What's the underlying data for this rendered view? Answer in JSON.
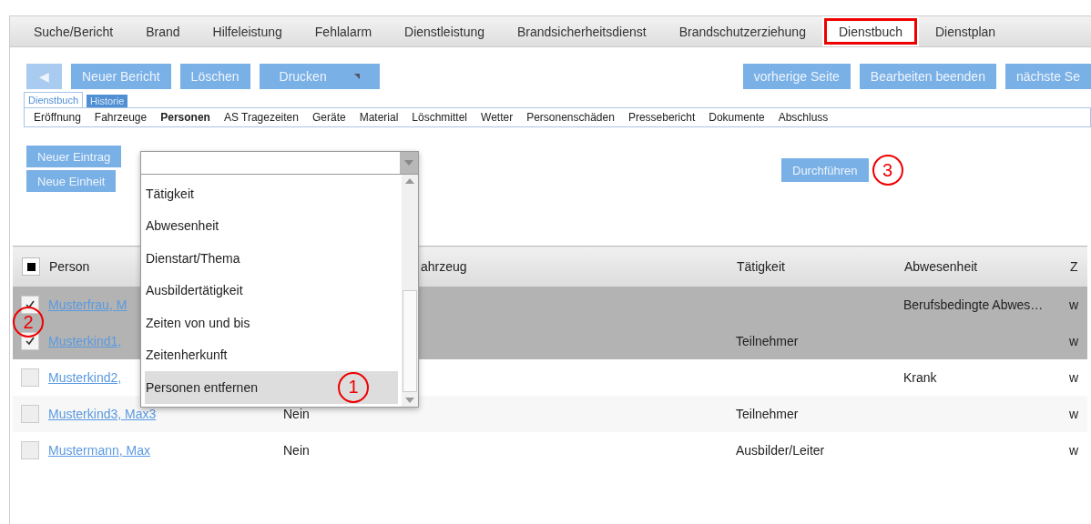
{
  "main_tabs": [
    {
      "label": "Suche/Bericht",
      "selected": false,
      "highlighted": false
    },
    {
      "label": "Brand",
      "selected": false,
      "highlighted": false
    },
    {
      "label": "Hilfeleistung",
      "selected": false,
      "highlighted": false
    },
    {
      "label": "Fehlalarm",
      "selected": false,
      "highlighted": false
    },
    {
      "label": "Dienstleistung",
      "selected": false,
      "highlighted": false
    },
    {
      "label": "Brandsicherheitsdienst",
      "selected": false,
      "highlighted": false
    },
    {
      "label": "Brandschutzerziehung",
      "selected": false,
      "highlighted": false
    },
    {
      "label": "Dienstbuch",
      "selected": true,
      "highlighted": true
    },
    {
      "label": "Dienstplan",
      "selected": false,
      "highlighted": false
    }
  ],
  "toolbar_left": [
    {
      "kind": "back",
      "label": "◀"
    },
    {
      "kind": "button",
      "label": "Neuer Bericht"
    },
    {
      "kind": "button",
      "label": "Löschen"
    },
    {
      "kind": "menu",
      "label": "Drucken"
    }
  ],
  "toolbar_right": [
    "vorherige Seite",
    "Bearbeiten beenden",
    "nächste Se"
  ],
  "sub_tabs": [
    {
      "label": "Dienstbuch",
      "selected": true
    },
    {
      "label": "Historie",
      "selected": false
    }
  ],
  "sections": [
    {
      "label": "Eröffnung",
      "selected": false
    },
    {
      "label": "Fahrzeuge",
      "selected": false
    },
    {
      "label": "Personen",
      "selected": true
    },
    {
      "label": "AS Tragezeiten",
      "selected": false
    },
    {
      "label": "Geräte",
      "selected": false
    },
    {
      "label": "Material",
      "selected": false
    },
    {
      "label": "Löschmittel",
      "selected": false
    },
    {
      "label": "Wetter",
      "selected": false
    },
    {
      "label": "Personenschäden",
      "selected": false
    },
    {
      "label": "Pressebericht",
      "selected": false
    },
    {
      "label": "Dokumente",
      "selected": false
    },
    {
      "label": "Abschluss",
      "selected": false
    }
  ],
  "entry_buttons": [
    "Neuer Eintrag",
    "Neue Einheit"
  ],
  "action_dropdown": {
    "options": [
      {
        "label": "Tätigkeit",
        "selected": false
      },
      {
        "label": "Abwesenheit",
        "selected": false
      },
      {
        "label": "Dienstart/Thema",
        "selected": false
      },
      {
        "label": "Ausbildertätigkeit",
        "selected": false
      },
      {
        "label": "Zeiten von und bis",
        "selected": false
      },
      {
        "label": "Zeitenherkunft",
        "selected": false
      },
      {
        "label": "Personen entfernen",
        "selected": true,
        "marker": "1"
      }
    ]
  },
  "execute_button": {
    "label": "Durchführen",
    "marker": "3"
  },
  "table": {
    "select_all_checked": true,
    "columns": [
      "Person",
      "ahrzeug",
      "Tätigkeit",
      "Abwesenheit",
      "Z"
    ],
    "rows": [
      {
        "person": "Musterfrau, M",
        "column_2": "",
        "vehicle": "",
        "activity": "",
        "absence": "Berufsbedingte Abwes…",
        "column_6": "w",
        "checked": true,
        "selected": true
      },
      {
        "person": "Musterkind1, ",
        "column_2": "",
        "vehicle": "",
        "activity": "Teilnehmer",
        "absence": "",
        "column_6": "w",
        "checked": true,
        "selected": true
      },
      {
        "person": "Musterkind2, ",
        "column_2": "",
        "vehicle": "",
        "activity": "",
        "absence": "Krank",
        "column_6": "w",
        "checked": false,
        "selected": false
      },
      {
        "person": "Musterkind3, Max3",
        "column_2": "Nein",
        "vehicle": "",
        "activity": "Teilnehmer",
        "absence": "",
        "column_6": "w",
        "checked": false,
        "selected": false
      },
      {
        "person": "Mustermann, Max",
        "column_2": "Nein",
        "vehicle": "",
        "activity": "Ausbilder/Leiter",
        "absence": "",
        "column_6": "w",
        "checked": false,
        "selected": false
      }
    ],
    "checkbox_marker": "2"
  }
}
